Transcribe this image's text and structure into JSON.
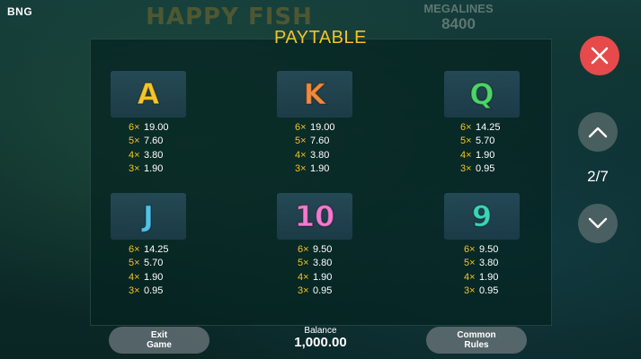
{
  "brand": "BNG",
  "background": {
    "game_logo": "HAPPY FISH",
    "megalines_label": "MEGALINES",
    "megalines_value": "8400"
  },
  "title": "PAYTABLE",
  "symbols": [
    {
      "letter": "A",
      "color": "#f5c52a",
      "pays": [
        {
          "mult": "6×",
          "value": "19.00"
        },
        {
          "mult": "5×",
          "value": "7.60"
        },
        {
          "mult": "4×",
          "value": "3.80"
        },
        {
          "mult": "3×",
          "value": "1.90"
        }
      ]
    },
    {
      "letter": "K",
      "color": "#f08a3c",
      "pays": [
        {
          "mult": "6×",
          "value": "19.00"
        },
        {
          "mult": "5×",
          "value": "7.60"
        },
        {
          "mult": "4×",
          "value": "3.80"
        },
        {
          "mult": "3×",
          "value": "1.90"
        }
      ]
    },
    {
      "letter": "Q",
      "color": "#4cd56a",
      "pays": [
        {
          "mult": "6×",
          "value": "14.25"
        },
        {
          "mult": "5×",
          "value": "5.70"
        },
        {
          "mult": "4×",
          "value": "1.90"
        },
        {
          "mult": "3×",
          "value": "0.95"
        }
      ]
    },
    {
      "letter": "J",
      "color": "#4fc3e8",
      "pays": [
        {
          "mult": "6×",
          "value": "14.25"
        },
        {
          "mult": "5×",
          "value": "5.70"
        },
        {
          "mult": "4×",
          "value": "1.90"
        },
        {
          "mult": "3×",
          "value": "0.95"
        }
      ]
    },
    {
      "letter": "10",
      "color": "#f27ad0",
      "pays": [
        {
          "mult": "6×",
          "value": "9.50"
        },
        {
          "mult": "5×",
          "value": "3.80"
        },
        {
          "mult": "4×",
          "value": "1.90"
        },
        {
          "mult": "3×",
          "value": "0.95"
        }
      ]
    },
    {
      "letter": "9",
      "color": "#3ad6b8",
      "pays": [
        {
          "mult": "6×",
          "value": "9.50"
        },
        {
          "mult": "5×",
          "value": "3.80"
        },
        {
          "mult": "4×",
          "value": "1.90"
        },
        {
          "mult": "3×",
          "value": "0.95"
        }
      ]
    }
  ],
  "page_indicator": "2/7",
  "buttons": {
    "exit_line1": "Exit",
    "exit_line2": "Game",
    "rules_line1": "Common",
    "rules_line2": "Rules",
    "close_icon": "close-icon",
    "up_icon": "chevron-up-icon",
    "down_icon": "chevron-down-icon"
  },
  "balance": {
    "label": "Balance",
    "value": "1,000.00"
  },
  "colors": {
    "accent": "#f4c325",
    "close": "#e64a4a"
  }
}
